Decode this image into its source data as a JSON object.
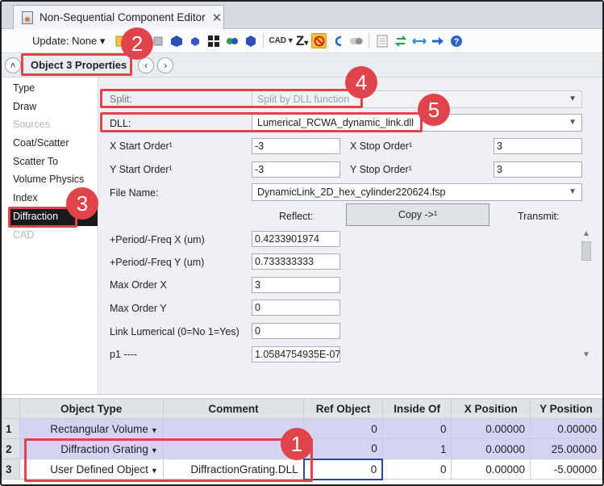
{
  "window": {
    "tab_title": "Non-Sequential Component Editor",
    "close_glyph": "✕"
  },
  "toolbar": {
    "update_label": "Update: None ▾",
    "cad_label": "CAD ▾",
    "z_label": "Z",
    "z_arrow": "▾"
  },
  "properties_bar": {
    "prev": "‹",
    "next": "›",
    "collapse": "˄",
    "header": "Object  3 Properties"
  },
  "nav": {
    "items": [
      {
        "label": "Type",
        "state": "normal"
      },
      {
        "label": "Draw",
        "state": "normal"
      },
      {
        "label": "Sources",
        "state": "disabled"
      },
      {
        "label": "Coat/Scatter",
        "state": "normal"
      },
      {
        "label": "Scatter To",
        "state": "normal"
      },
      {
        "label": "Volume Physics",
        "state": "normal"
      },
      {
        "label": "Index",
        "state": "normal"
      },
      {
        "label": "Diffraction",
        "state": "active"
      },
      {
        "label": "CAD",
        "state": "disabled"
      }
    ]
  },
  "diffraction": {
    "split_label": "Split:",
    "split_value": "Split by DLL function",
    "dll_label": "DLL:",
    "dll_value": "Lumerical_RCWA_dynamic_link.dll",
    "x_start_label": "X Start Order¹",
    "x_start_value": "-3",
    "x_stop_label": "X Stop Order¹",
    "x_stop_value": "3",
    "y_start_label": "Y Start Order¹",
    "y_start_value": "-3",
    "y_stop_label": "Y Stop Order¹",
    "y_stop_value": "3",
    "file_name_label": "File Name:",
    "file_name_value": "DynamicLink_2D_hex_cylinder220624.fsp",
    "reflect_label": "Reflect:",
    "copy_label": "Copy ->¹",
    "transmit_label": "Transmit:",
    "params": [
      {
        "label": "+Period/-Freq X (um)",
        "value": "0.4233901974"
      },
      {
        "label": "+Period/-Freq Y (um)",
        "value": "0.733333333"
      },
      {
        "label": "Max Order X",
        "value": "3"
      },
      {
        "label": "Max Order Y",
        "value": "0"
      },
      {
        "label": "Link Lumerical (0=No 1=Yes)",
        "value": "0"
      },
      {
        "label": "p1 ----",
        "value": "1.0584754935E-07"
      }
    ]
  },
  "table": {
    "headers": [
      "",
      "Object Type",
      "Comment",
      "Ref Object",
      "Inside Of",
      "X Position",
      "Y Position"
    ],
    "rows": [
      {
        "num": "1",
        "type": "Rectangular Volume",
        "comment": "",
        "ref": "0",
        "inside": "0",
        "x": "0.00000",
        "y": "0.00000"
      },
      {
        "num": "2",
        "type": "Diffraction Grating",
        "comment": "",
        "ref": "0",
        "inside": "1",
        "x": "0.00000",
        "y": "25.00000"
      },
      {
        "num": "3",
        "type": "User Defined Object",
        "comment": "DiffractionGrating.DLL",
        "ref": "0",
        "inside": "0",
        "x": "0.00000",
        "y": "-5.00000"
      }
    ]
  },
  "annotations": {
    "colors": {
      "annotation": "#e0434a"
    },
    "badges": [
      "1",
      "2",
      "3",
      "4",
      "5"
    ]
  }
}
